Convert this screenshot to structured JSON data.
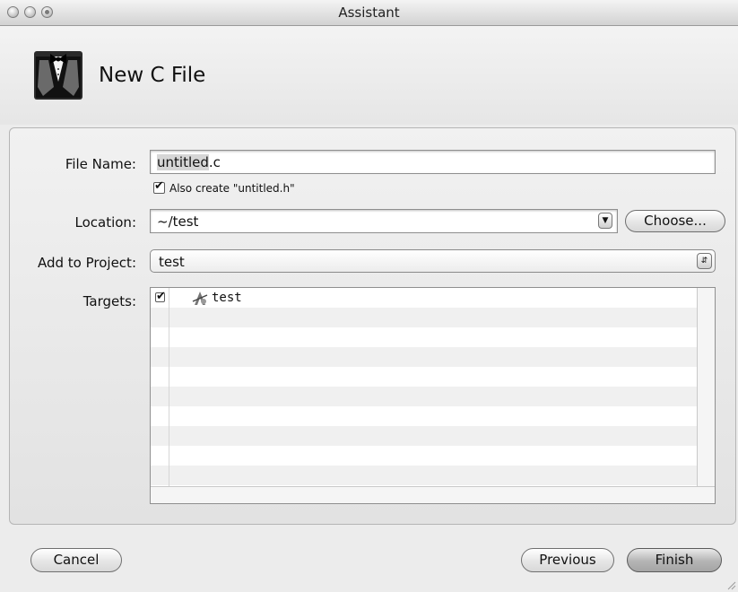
{
  "window": {
    "title": "Assistant"
  },
  "header": {
    "title": "New C File",
    "icon": "tuxedo-assistant-icon"
  },
  "form": {
    "file_name_label": "File Name:",
    "file_name_selected": "untitled",
    "file_name_extension": ".c",
    "also_create_label": "Also create \"untitled.h\"",
    "also_create_checked": true,
    "location_label": "Location:",
    "location_value": "~/test",
    "choose_button": "Choose...",
    "project_label": "Add to Project:",
    "project_value": "test",
    "targets_label": "Targets:"
  },
  "targets": [
    {
      "name": "test",
      "checked": true,
      "icon": "target-app-icon"
    }
  ],
  "footer": {
    "cancel_button": "Cancel",
    "previous_button": "Previous",
    "finish_button": "Finish"
  }
}
